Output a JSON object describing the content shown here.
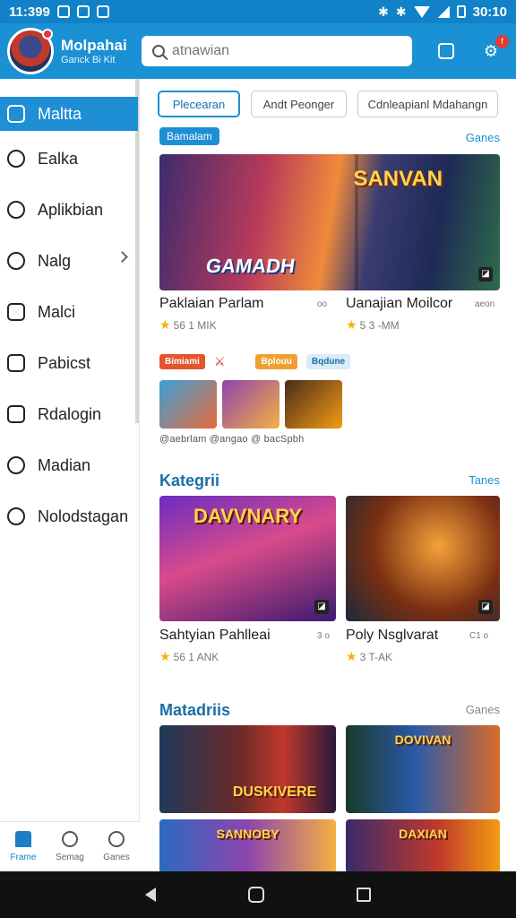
{
  "status_bar": {
    "time": "11:399",
    "right_text": "30:10"
  },
  "header": {
    "app_name": "Molpahai",
    "app_subtitle": "Ganck Bi Kit",
    "search_placeholder": "atnawian",
    "notification_count": "f"
  },
  "sidebar": {
    "items": [
      {
        "label": "Maltta",
        "icon": "grid-icon",
        "active": true
      },
      {
        "label": "Ealka",
        "icon": "swirl-icon"
      },
      {
        "label": "Aplikbian",
        "icon": "chat-icon"
      },
      {
        "label": "Nalg",
        "icon": "gear-icon",
        "has_chevron": true
      },
      {
        "label": "Malci",
        "icon": "wallet-icon"
      },
      {
        "label": "Pabicst",
        "icon": "square-icon"
      },
      {
        "label": "Rdalogin",
        "icon": "face-icon"
      },
      {
        "label": "Madian",
        "icon": "diamond-icon"
      },
      {
        "label": "Nolodstagan",
        "icon": "shield-icon"
      }
    ]
  },
  "bottom_nav": [
    {
      "label": "Frame",
      "icon": "home-icon",
      "active": true
    },
    {
      "label": "Semag",
      "icon": "check-icon"
    },
    {
      "label": "Ganes",
      "icon": "sparkle-icon"
    }
  ],
  "main": {
    "chips": [
      "Plecearan",
      "Andt Peonger",
      "Cdnleapianl Mdahangn"
    ],
    "featured": {
      "pill": "Bamalam",
      "see_all": "Ganes",
      "hero_logo_left": "GAMADH",
      "hero_logo_right": "SANVAN",
      "cards": [
        {
          "title": "Paklaian Parlam",
          "side": "oo",
          "rating": "56 1 MIK"
        },
        {
          "title": "Uanajian Moilcor",
          "side": "aeon",
          "rating": "5 3 -MM"
        }
      ]
    },
    "mini": {
      "badges": [
        "Bimiami",
        "Bplouu",
        "Bqdune"
      ],
      "labels": "@aebrlam   @angao   @ bacSpbh"
    },
    "kategori": {
      "title": "Kategrii",
      "see_all": "Tanes",
      "tile_logos": [
        "DAVVNARY",
        ""
      ],
      "cards": [
        {
          "title": "Sahtyian Pahlleai",
          "side": "3 o",
          "rating": "56 1 ANK"
        },
        {
          "title": "Poly Nsglvarat",
          "side": "C1 o",
          "rating": "3 T-AK"
        }
      ]
    },
    "matadriis": {
      "title": "Matadriis",
      "see_all": "Ganes",
      "tile_logos": [
        "DUSKIVERE",
        "DOVIVAN",
        "SANNOBY",
        "DAXIAN"
      ]
    }
  },
  "colors": {
    "accent": "#1e8fd4",
    "header": "#1a90d5",
    "star": "#f5b301"
  }
}
